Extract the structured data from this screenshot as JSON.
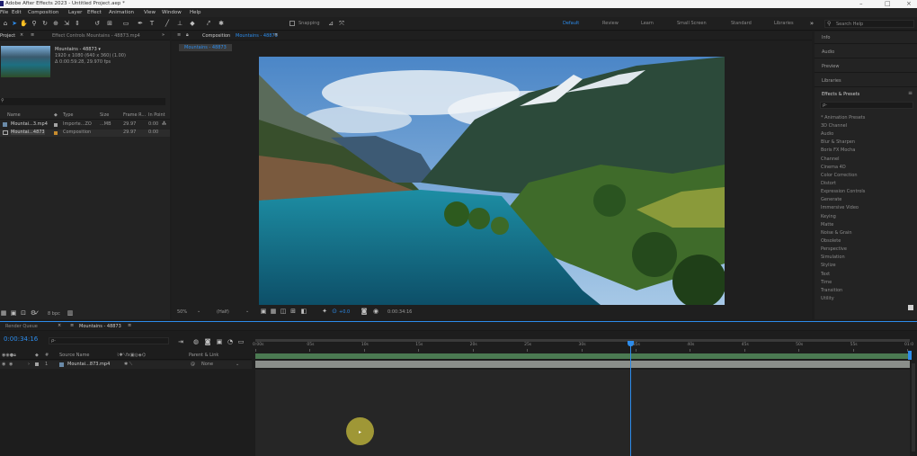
{
  "window": {
    "title": "Adobe After Effects 2023 - Untitled Project.aep *"
  },
  "menu": [
    "File",
    "Edit",
    "Composition",
    "Layer",
    "Effect",
    "Animation",
    "View",
    "Window",
    "Help"
  ],
  "toolbar": {
    "snapping_label": "Snapping",
    "workspaces": [
      "Default",
      "Review",
      "Learn",
      "Small Screen",
      "Standard",
      "Libraries"
    ],
    "search_help_placeholder": "Search Help"
  },
  "project_panel": {
    "tab_label": "Project",
    "effect_controls_tab": "Effect Controls Mountains - 48873.mp4",
    "item_name": "Mountains - 48873 ▾",
    "item_line1": "1920 x 1080 (640 x 360) (1.00)",
    "item_line2": "Δ 0:00:59:28, 29.970 fps",
    "columns": [
      "Name",
      "Type",
      "Size",
      "Frame R...",
      "In Point"
    ],
    "rows": [
      {
        "name": "Mountai...3.mp4",
        "type": "Importe...ZO",
        "size": "...MB",
        "fps": "29.97",
        "in": "0:00"
      },
      {
        "name": "Mountai...4873",
        "type": "Composition",
        "size": "",
        "fps": "29.97",
        "in": "0:00"
      }
    ],
    "bpc": "8 bpc"
  },
  "composition_panel": {
    "tab_label": "Composition",
    "comp_name": "Mountains - 48873",
    "breadcrumb": "Mountains - 48873",
    "zoom": "50%",
    "resolution": "(Half)",
    "timecode": "0:00:34:16"
  },
  "right_panels": {
    "info": "Info",
    "audio": "Audio",
    "preview": "Preview",
    "libraries": "Libraries",
    "effects_title": "Effects & Presets",
    "search_placeholder": "ρ-",
    "effects": [
      "* Animation Presets",
      "3D Channel",
      "Audio",
      "Blur & Sharpen",
      "Boris FX Mocha",
      "Channel",
      "Cinema 4D",
      "Color Correction",
      "Distort",
      "Expression Controls",
      "Generate",
      "Immersive Video",
      "Keying",
      "Matte",
      "Noise & Grain",
      "Obsolete",
      "Perspective",
      "Simulation",
      "Stylize",
      "Text",
      "Time",
      "Transition",
      "Utility"
    ]
  },
  "timeline": {
    "render_queue_tab": "Render Queue",
    "comp_tab": "Mountains - 48873",
    "timecode": "0:00:34:16",
    "search_placeholder": "ρ-",
    "columns": {
      "source_name": "Source Name",
      "parent_link": "Parent & Link"
    },
    "layer": {
      "index": "1",
      "name": "Mountai...873.mp4",
      "parent": "None"
    },
    "ruler_labels": [
      "0:00s",
      "05s",
      "10s",
      "15s",
      "20s",
      "25s",
      "30s",
      "35s",
      "40s",
      "45s",
      "50s",
      "55s",
      "01:0"
    ],
    "playhead_fraction": 0.575
  },
  "colors": {
    "accent_blue": "#2d8ceb",
    "track_bar": "#4b7a52",
    "layer_bar": "#8a8e8a"
  }
}
